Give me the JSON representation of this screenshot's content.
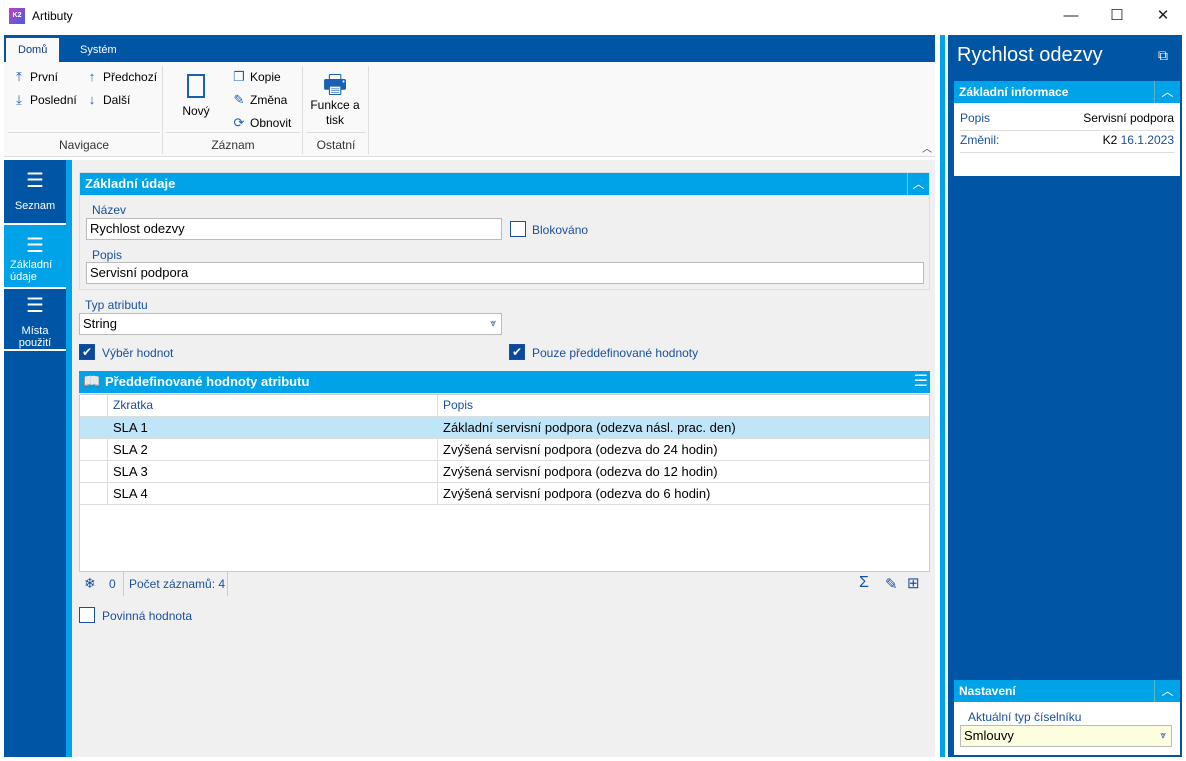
{
  "window": {
    "title": "Artibuty",
    "logo": "K2",
    "minimize": "—",
    "maximize": "☐",
    "close": "✕"
  },
  "ribbon": {
    "tabs": [
      "Domů",
      "Systém"
    ],
    "navigation": {
      "first": "První",
      "last": "Poslední",
      "previous": "Předchozí",
      "next": "Další",
      "group": "Navigace"
    },
    "record": {
      "new": "Nový",
      "copy": "Kopie",
      "change": "Změna",
      "refresh": "Obnovit",
      "group": "Záznam"
    },
    "other": {
      "print": "Funkce a tisk",
      "group": "Ostatní"
    }
  },
  "sidebar": {
    "items": [
      {
        "label": "Seznam"
      },
      {
        "label": "Základní údaje"
      },
      {
        "label": "Místa použití"
      }
    ]
  },
  "form": {
    "section_title": "Základní údaje",
    "name_label": "Název",
    "name_value": "Rychlost odezvy",
    "blocked_label": "Blokováno",
    "desc_label": "Popis",
    "desc_value": "Servisní podpora",
    "type_label": "Typ atributu",
    "type_value": "String",
    "value_select_label": "Výběr hodnot",
    "predefined_only_label": "Pouze předdefinované hodnoty",
    "required_label": "Povinná hodnota"
  },
  "grid": {
    "title": "Předdefinované hodnoty atributu",
    "columns": [
      "Zkratka",
      "Popis"
    ],
    "rows": [
      [
        "SLA 1",
        "Základní servisní podpora (odezva násl. prac. den)"
      ],
      [
        "SLA 2",
        "Zvýšená servisní podpora (odezva do 24 hodin)"
      ],
      [
        "SLA 3",
        "Zvýšená servisní podpora (odezva do 12 hodin)"
      ],
      [
        "SLA 4",
        "Zvýšená servisní podpora (odezva do 6 hodin)"
      ]
    ],
    "selected_count": "0",
    "record_count": "Počet záznamů: 4"
  },
  "panel": {
    "title": "Rychlost odezvy",
    "info_title": "Základní informace",
    "desc_label": "Popis",
    "desc_value": "Servisní podpora",
    "changed_label": "Změnil:",
    "changed_user": "K2",
    "changed_date": "16.1.2023",
    "settings_title": "Nastavení",
    "codelist_label": "Aktuální typ číselníku",
    "codelist_value": "Smlouvy"
  }
}
